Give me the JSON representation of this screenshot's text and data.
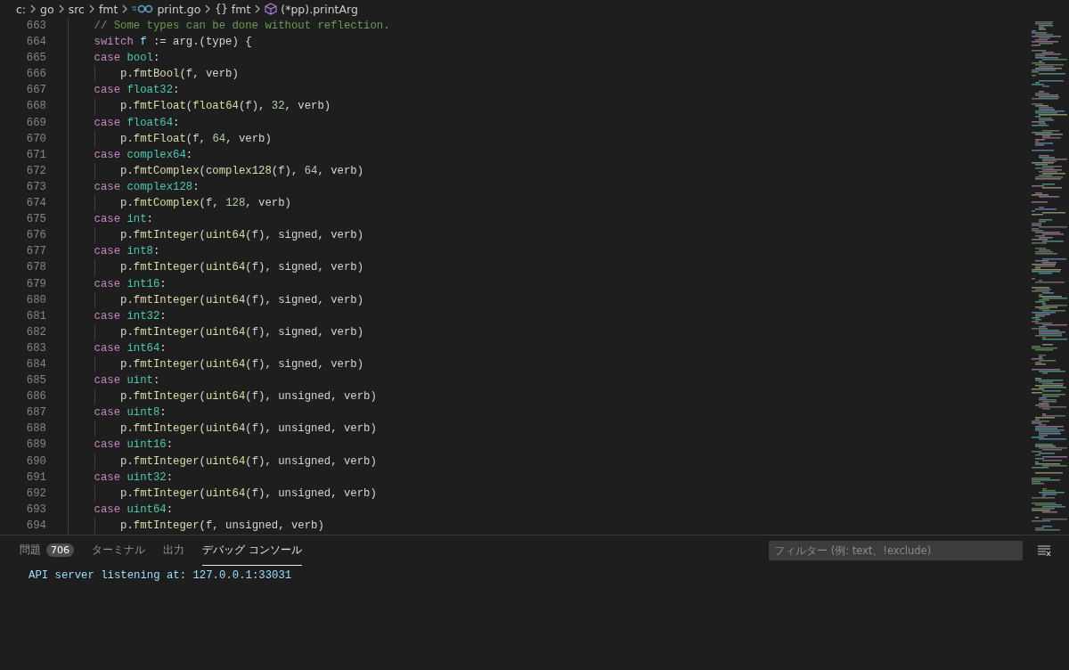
{
  "breadcrumb": [
    {
      "text": "c:",
      "kind": "folder"
    },
    {
      "text": "go",
      "kind": "folder"
    },
    {
      "text": "src",
      "kind": "folder"
    },
    {
      "text": "fmt",
      "kind": "folder"
    },
    {
      "text": "print.go",
      "kind": "gofile"
    },
    {
      "text": "fmt",
      "kind": "namespace",
      "glyph": "{}"
    },
    {
      "text": "(*pp).printArg",
      "kind": "method"
    }
  ],
  "editor": {
    "lines": [
      {
        "number": "663",
        "tokens": [
          {
            "text": "    // Some types can be done without reflection.",
            "kind": "comment"
          }
        ]
      },
      {
        "number": "664",
        "tokens": [
          {
            "text": "    switch",
            "kind": "keyword"
          },
          {
            "text": " f",
            "kind": "variable"
          },
          {
            "text": " := arg.(type) {"
          }
        ]
      },
      {
        "number": "665",
        "tokens": [
          {
            "text": "    case",
            "kind": "keyword"
          },
          {
            "text": " bool",
            "kind": "type"
          },
          {
            "text": ":"
          }
        ]
      },
      {
        "number": "666",
        "tokens": [
          {
            "text": "        p."
          },
          {
            "text": "fmtBool",
            "kind": "function"
          },
          {
            "text": "(f, verb)"
          }
        ]
      },
      {
        "number": "667",
        "tokens": [
          {
            "text": "    case",
            "kind": "keyword"
          },
          {
            "text": " float32",
            "kind": "type"
          },
          {
            "text": ":"
          }
        ]
      },
      {
        "number": "668",
        "tokens": [
          {
            "text": "        p."
          },
          {
            "text": "fmtFloat",
            "kind": "function"
          },
          {
            "text": "("
          },
          {
            "text": "float64",
            "kind": "function"
          },
          {
            "text": "(f), "
          },
          {
            "text": "32",
            "kind": "number"
          },
          {
            "text": ", verb)"
          }
        ]
      },
      {
        "number": "669",
        "tokens": [
          {
            "text": "    case",
            "kind": "keyword"
          },
          {
            "text": " float64",
            "kind": "type"
          },
          {
            "text": ":"
          }
        ]
      },
      {
        "number": "670",
        "tokens": [
          {
            "text": "        p."
          },
          {
            "text": "fmtFloat",
            "kind": "function"
          },
          {
            "text": "(f, "
          },
          {
            "text": "64",
            "kind": "number"
          },
          {
            "text": ", verb)"
          }
        ]
      },
      {
        "number": "671",
        "tokens": [
          {
            "text": "    case",
            "kind": "keyword"
          },
          {
            "text": " complex64",
            "kind": "type"
          },
          {
            "text": ":"
          }
        ]
      },
      {
        "number": "672",
        "tokens": [
          {
            "text": "        p."
          },
          {
            "text": "fmtComplex",
            "kind": "function"
          },
          {
            "text": "("
          },
          {
            "text": "complex128",
            "kind": "function"
          },
          {
            "text": "(f), "
          },
          {
            "text": "64",
            "kind": "number"
          },
          {
            "text": ", verb)"
          }
        ]
      },
      {
        "number": "673",
        "tokens": [
          {
            "text": "    case",
            "kind": "keyword"
          },
          {
            "text": " complex128",
            "kind": "type"
          },
          {
            "text": ":"
          }
        ]
      },
      {
        "number": "674",
        "tokens": [
          {
            "text": "        p."
          },
          {
            "text": "fmtComplex",
            "kind": "function"
          },
          {
            "text": "(f, "
          },
          {
            "text": "128",
            "kind": "number"
          },
          {
            "text": ", verb)"
          }
        ]
      },
      {
        "number": "675",
        "tokens": [
          {
            "text": "    case",
            "kind": "keyword"
          },
          {
            "text": " int",
            "kind": "type"
          },
          {
            "text": ":"
          }
        ]
      },
      {
        "number": "676",
        "tokens": [
          {
            "text": "        p."
          },
          {
            "text": "fmtInteger",
            "kind": "function"
          },
          {
            "text": "("
          },
          {
            "text": "uint64",
            "kind": "function"
          },
          {
            "text": "(f), signed, verb)"
          }
        ]
      },
      {
        "number": "677",
        "tokens": [
          {
            "text": "    case",
            "kind": "keyword"
          },
          {
            "text": " int8",
            "kind": "type"
          },
          {
            "text": ":"
          }
        ]
      },
      {
        "number": "678",
        "tokens": [
          {
            "text": "        p."
          },
          {
            "text": "fmtInteger",
            "kind": "function"
          },
          {
            "text": "("
          },
          {
            "text": "uint64",
            "kind": "function"
          },
          {
            "text": "(f), signed, verb)"
          }
        ]
      },
      {
        "number": "679",
        "tokens": [
          {
            "text": "    case",
            "kind": "keyword"
          },
          {
            "text": " int16",
            "kind": "type"
          },
          {
            "text": ":"
          }
        ]
      },
      {
        "number": "680",
        "tokens": [
          {
            "text": "        p."
          },
          {
            "text": "fmtInteger",
            "kind": "function"
          },
          {
            "text": "("
          },
          {
            "text": "uint64",
            "kind": "function"
          },
          {
            "text": "(f), signed, verb)"
          }
        ]
      },
      {
        "number": "681",
        "tokens": [
          {
            "text": "    case",
            "kind": "keyword"
          },
          {
            "text": " int32",
            "kind": "type"
          },
          {
            "text": ":"
          }
        ]
      },
      {
        "number": "682",
        "tokens": [
          {
            "text": "        p."
          },
          {
            "text": "fmtInteger",
            "kind": "function"
          },
          {
            "text": "("
          },
          {
            "text": "uint64",
            "kind": "function"
          },
          {
            "text": "(f), signed, verb)"
          }
        ]
      },
      {
        "number": "683",
        "tokens": [
          {
            "text": "    case",
            "kind": "keyword"
          },
          {
            "text": " int64",
            "kind": "type"
          },
          {
            "text": ":"
          }
        ]
      },
      {
        "number": "684",
        "tokens": [
          {
            "text": "        p."
          },
          {
            "text": "fmtInteger",
            "kind": "function"
          },
          {
            "text": "("
          },
          {
            "text": "uint64",
            "kind": "function"
          },
          {
            "text": "(f), signed, verb)"
          }
        ]
      },
      {
        "number": "685",
        "tokens": [
          {
            "text": "    case",
            "kind": "keyword"
          },
          {
            "text": " uint",
            "kind": "type"
          },
          {
            "text": ":"
          }
        ]
      },
      {
        "number": "686",
        "tokens": [
          {
            "text": "        p."
          },
          {
            "text": "fmtInteger",
            "kind": "function"
          },
          {
            "text": "("
          },
          {
            "text": "uint64",
            "kind": "function"
          },
          {
            "text": "(f), unsigned, verb)"
          }
        ]
      },
      {
        "number": "687",
        "tokens": [
          {
            "text": "    case",
            "kind": "keyword"
          },
          {
            "text": " uint8",
            "kind": "type"
          },
          {
            "text": ":"
          }
        ]
      },
      {
        "number": "688",
        "tokens": [
          {
            "text": "        p."
          },
          {
            "text": "fmtInteger",
            "kind": "function"
          },
          {
            "text": "("
          },
          {
            "text": "uint64",
            "kind": "function"
          },
          {
            "text": "(f), unsigned, verb)"
          }
        ]
      },
      {
        "number": "689",
        "tokens": [
          {
            "text": "    case",
            "kind": "keyword"
          },
          {
            "text": " uint16",
            "kind": "type"
          },
          {
            "text": ":"
          }
        ]
      },
      {
        "number": "690",
        "tokens": [
          {
            "text": "        p."
          },
          {
            "text": "fmtInteger",
            "kind": "function"
          },
          {
            "text": "("
          },
          {
            "text": "uint64",
            "kind": "function"
          },
          {
            "text": "(f), unsigned, verb)"
          }
        ]
      },
      {
        "number": "691",
        "tokens": [
          {
            "text": "    case",
            "kind": "keyword"
          },
          {
            "text": " uint32",
            "kind": "type"
          },
          {
            "text": ":"
          }
        ]
      },
      {
        "number": "692",
        "tokens": [
          {
            "text": "        p."
          },
          {
            "text": "fmtInteger",
            "kind": "function"
          },
          {
            "text": "("
          },
          {
            "text": "uint64",
            "kind": "function"
          },
          {
            "text": "(f), unsigned, verb)"
          }
        ]
      },
      {
        "number": "693",
        "tokens": [
          {
            "text": "    case",
            "kind": "keyword"
          },
          {
            "text": " uint64",
            "kind": "type"
          },
          {
            "text": ":"
          }
        ]
      },
      {
        "number": "694",
        "tokens": [
          {
            "text": "        p."
          },
          {
            "text": "fmtInteger",
            "kind": "function"
          },
          {
            "text": "(f, unsigned, verb)"
          }
        ]
      }
    ]
  },
  "panel": {
    "tabs": [
      {
        "label": "問題",
        "badge": "706",
        "selected": false
      },
      {
        "label": "ターミナル",
        "selected": false
      },
      {
        "label": "出力",
        "selected": false
      },
      {
        "label": "デバッグ コンソール",
        "selected": true
      }
    ],
    "filter": {
      "placeholder": "フィルター (例: text、!exclude)"
    },
    "output": [
      "API server listening at: 127.0.0.1:33031"
    ]
  }
}
